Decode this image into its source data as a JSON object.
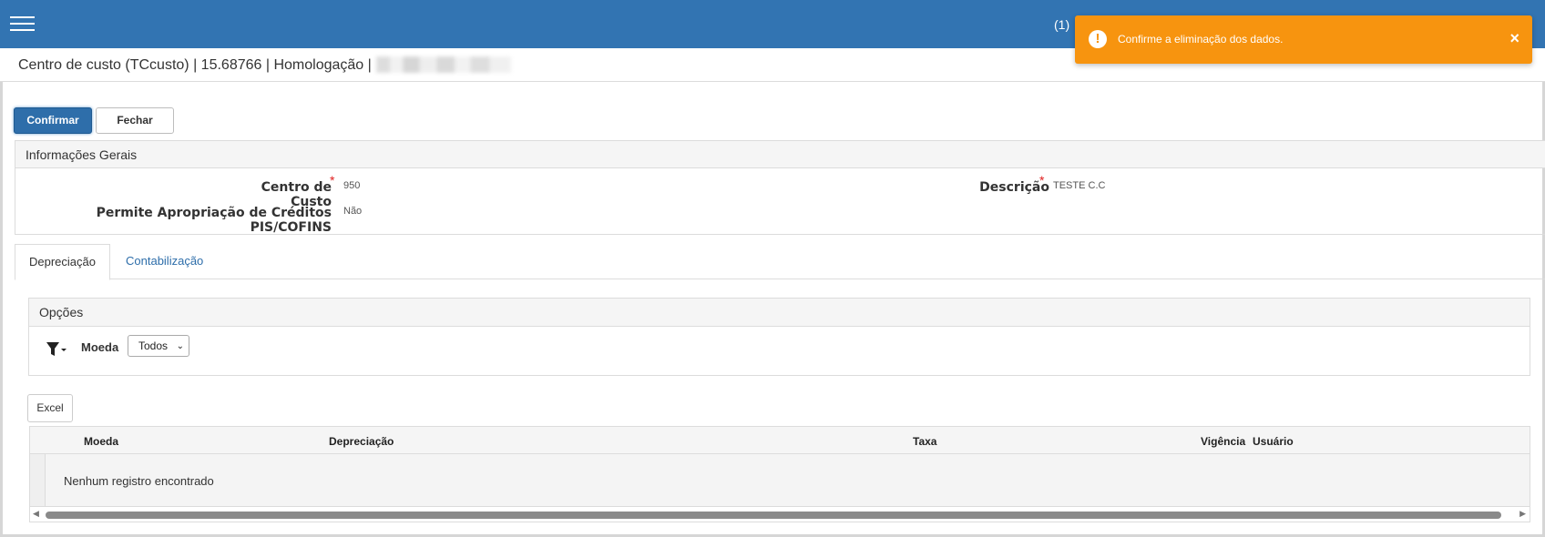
{
  "header": {
    "counter": "(1)",
    "page_title": "Centro de custo (TCcusto) | 15.68766 | Homologação |"
  },
  "toast": {
    "message": "Confirme a eliminação dos dados.",
    "icon": "!",
    "close": "×",
    "color": "#f7940f"
  },
  "actions": {
    "confirm_label": "Confirmar",
    "close_label": "Fechar"
  },
  "info": {
    "title": "Informações Gerais",
    "fields": [
      {
        "label": "Centro de Custo",
        "value": "950",
        "required": "*"
      },
      {
        "label": "Descrição",
        "value": "TESTE C.C",
        "required": "*"
      },
      {
        "label": "Permite Apropriação de Créditos PIS/COFINS",
        "value": "Não"
      }
    ]
  },
  "tabs": [
    {
      "label": "Depreciação",
      "active": true
    },
    {
      "label": "Contabilização",
      "active": false
    }
  ],
  "options": {
    "title": "Opções",
    "moeda_label": "Moeda",
    "moeda_selected": "Todos",
    "chevron": "⌄"
  },
  "excel_label": "Excel",
  "grid": {
    "columns": [
      "Moeda",
      "Depreciação",
      "Taxa",
      "Vigência",
      "Usuário"
    ],
    "empty_message": "Nenhum registro encontrado"
  },
  "colors": {
    "topbar": "#3274b2",
    "primary_button": "#2e6eaa",
    "required": "#e02020"
  }
}
